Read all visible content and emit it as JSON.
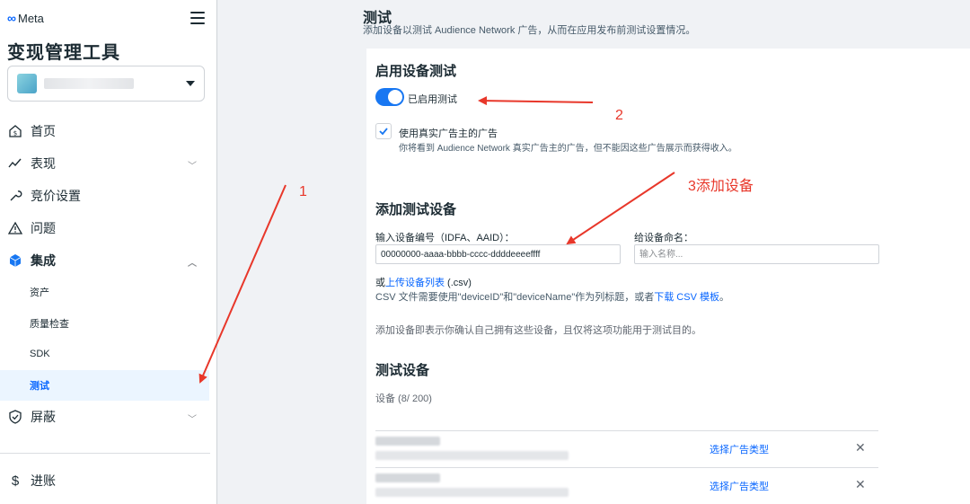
{
  "sidebar": {
    "brand": "Meta",
    "title": "变现管理工具",
    "nav": [
      {
        "label": "首页"
      },
      {
        "label": "表现"
      },
      {
        "label": "竞价设置"
      },
      {
        "label": "问题"
      },
      {
        "label": "集成"
      }
    ],
    "subnav": [
      {
        "label": "资产"
      },
      {
        "label": "质量检查"
      },
      {
        "label": "SDK"
      },
      {
        "label": "测试"
      }
    ],
    "nav_after": {
      "label": "屏蔽"
    },
    "bottom": {
      "label": "进账"
    }
  },
  "page": {
    "title": "测试",
    "description": "添加设备以测试 Audience Network 广告，从而在应用发布前测试设置情况。"
  },
  "enable_section": {
    "title": "启用设备测试",
    "toggle_label": "已启用测试",
    "toggle_on": true,
    "checkbox_label": "使用真实广告主的广告",
    "checkbox_checked": true,
    "checkbox_sub": "你将看到 Audience Network 真实广告主的广告，但不能因这些广告展示而获得收入。"
  },
  "add_section": {
    "title": "添加测试设备",
    "device_id_label": "输入设备编号（IDFA、AAID）：",
    "device_id_value": "00000000-aaaa-bbbb-cccc-ddddeeeeffff",
    "device_name_label": "给设备命名：",
    "device_name_placeholder": "输入名称...",
    "upload_prefix": "或",
    "upload_link": "上传设备列表",
    "upload_suffix": " (.csv)",
    "csv_note": "CSV 文件需要使用\"deviceID\"和\"deviceName\"作为列标题，或者",
    "csv_link": "下载 CSV 模板",
    "csv_note_end": "。",
    "consent": "添加设备即表示你确认自己拥有这些设备，且仅将这项功能用于测试目的。"
  },
  "devices_section": {
    "title": "测试设备",
    "count": "设备 (8/ 200)",
    "rows": [
      {
        "action": "选择广告类型"
      },
      {
        "action": "选择广告类型"
      }
    ]
  },
  "annotations": {
    "a1": "1",
    "a2": "2",
    "a3": "3添加设备",
    "color": "#e8372a"
  }
}
